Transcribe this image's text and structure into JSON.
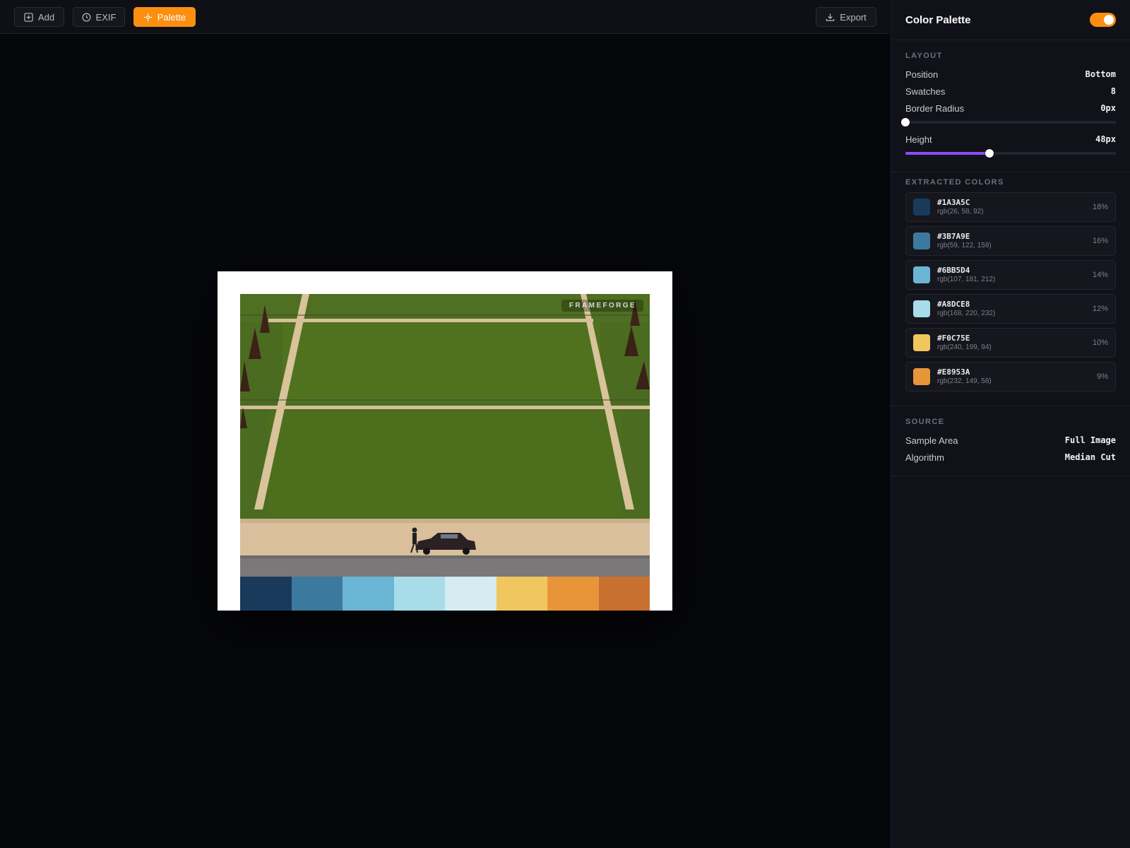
{
  "toolbar": {
    "add_label": "Add",
    "exif_label": "EXIF",
    "palette_label": "Palette",
    "export_label": "Export",
    "active_color": "#fb8f10"
  },
  "canvas": {
    "watermark": "FRAMEFORGE",
    "palette_strip": [
      "#1a3a5c",
      "#3b7a9e",
      "#6bb5d4",
      "#a8dce8",
      "#d4ecf2",
      "#f0c75e",
      "#e8953a",
      "#c8702f"
    ]
  },
  "panel": {
    "title": "Color Palette",
    "enabled": true,
    "layout": {
      "label": "LAYOUT",
      "position_label": "Position",
      "position_value": "Bottom",
      "swatches_label": "Swatches",
      "swatches_value": "8",
      "radius_label": "Border Radius",
      "radius_value": "0px",
      "radius_fraction": 0,
      "height_label": "Height",
      "height_value": "48px",
      "height_fraction": 0.4,
      "slider_accent": "#8b4dff"
    },
    "extracted": {
      "label": "EXTRACTED COLORS",
      "items": [
        {
          "hex": "#1A3A5C",
          "rgb": "rgb(26, 58, 92)",
          "pct": "18%",
          "color": "#1a3a5c"
        },
        {
          "hex": "#3B7A9E",
          "rgb": "rgb(59, 122, 158)",
          "pct": "16%",
          "color": "#3b7a9e"
        },
        {
          "hex": "#6BB5D4",
          "rgb": "rgb(107, 181, 212)",
          "pct": "14%",
          "color": "#6bb5d4"
        },
        {
          "hex": "#A8DCE8",
          "rgb": "rgb(168, 220, 232)",
          "pct": "12%",
          "color": "#a8dce8"
        },
        {
          "hex": "#F0C75E",
          "rgb": "rgb(240, 199, 94)",
          "pct": "10%",
          "color": "#f0c75e"
        },
        {
          "hex": "#E8953A",
          "rgb": "rgb(232, 149, 58)",
          "pct": "9%",
          "color": "#e8953a"
        }
      ]
    },
    "source": {
      "label": "SOURCE",
      "sample_label": "Sample Area",
      "sample_value": "Full Image",
      "algorithm_label": "Algorithm",
      "algorithm_value": "Median Cut"
    }
  }
}
